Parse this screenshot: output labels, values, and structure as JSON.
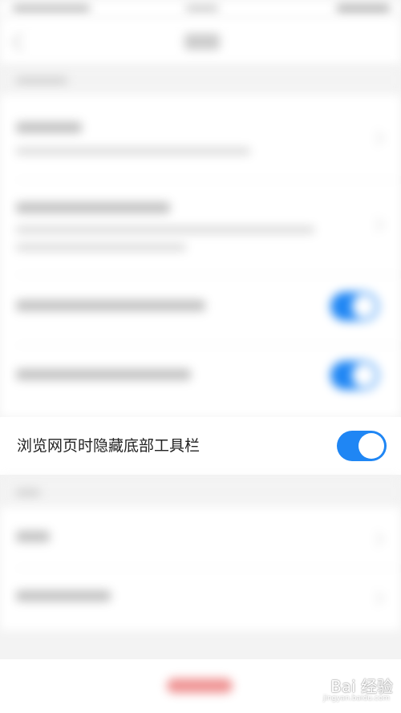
{
  "setting_row": {
    "label": "浏览网页时隐藏底部工具栏",
    "toggle_on": true
  },
  "other_toggles": [
    {
      "on": true
    },
    {
      "on": true
    }
  ],
  "colors": {
    "toggle_on": "#1f86f4",
    "background": "#f3f3f3",
    "card": "#ffffff",
    "footer_button": "#e23a3a"
  },
  "watermark": {
    "brand": "Bai 经验",
    "url": "jingyan.baidu.com"
  }
}
